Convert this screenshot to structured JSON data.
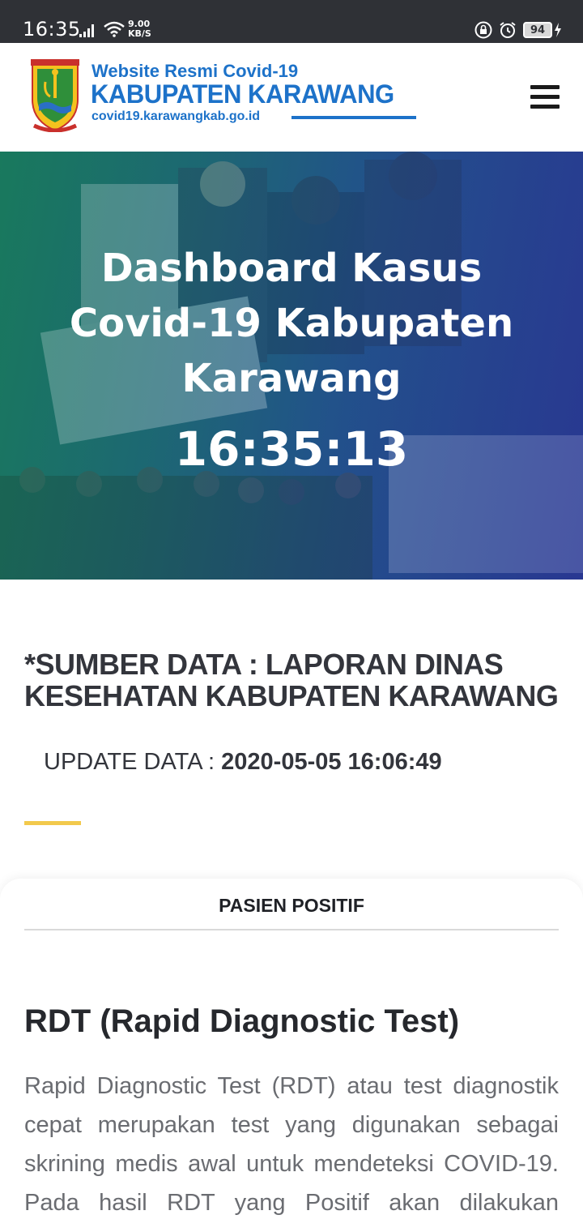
{
  "status_bar": {
    "time": "16:35",
    "net_speed_value": "9.00",
    "net_speed_unit": "KB/S",
    "battery": "94",
    "icons": [
      "signal-icon",
      "wifi-icon",
      "lock-icon",
      "alarm-icon",
      "battery-icon",
      "charging-icon"
    ]
  },
  "header": {
    "line1": "Website Resmi Covid-19",
    "line2": "KABUPATEN KARAWANG",
    "line3": "covid19.karawangkab.go.id",
    "brand_color": "#1d72c9"
  },
  "hero": {
    "title": "Dashboard Kasus Covid-19 Kabupaten Karawang",
    "clock": "16:35:13"
  },
  "source": {
    "text": "*SUMBER DATA : LAPORAN DINAS KESEHATAN KABUPATEN KARAWANG",
    "update_label": "UPDATE DATA : ",
    "update_value": "2020-05-05 16:06:49",
    "accent_color": "#f2c94c"
  },
  "card": {
    "tab_label": "PASIEN POSITIF",
    "rdt_title": "RDT (Rapid Diagnostic Test)",
    "rdt_description": "Rapid Diagnostic Test (RDT) atau test diagnostik cepat merupakan test yang digunakan sebagai skrining medis awal untuk mendeteksi COVID-19. Pada hasil RDT yang Positif akan dilakukan pemeriksaan lanjutan"
  }
}
